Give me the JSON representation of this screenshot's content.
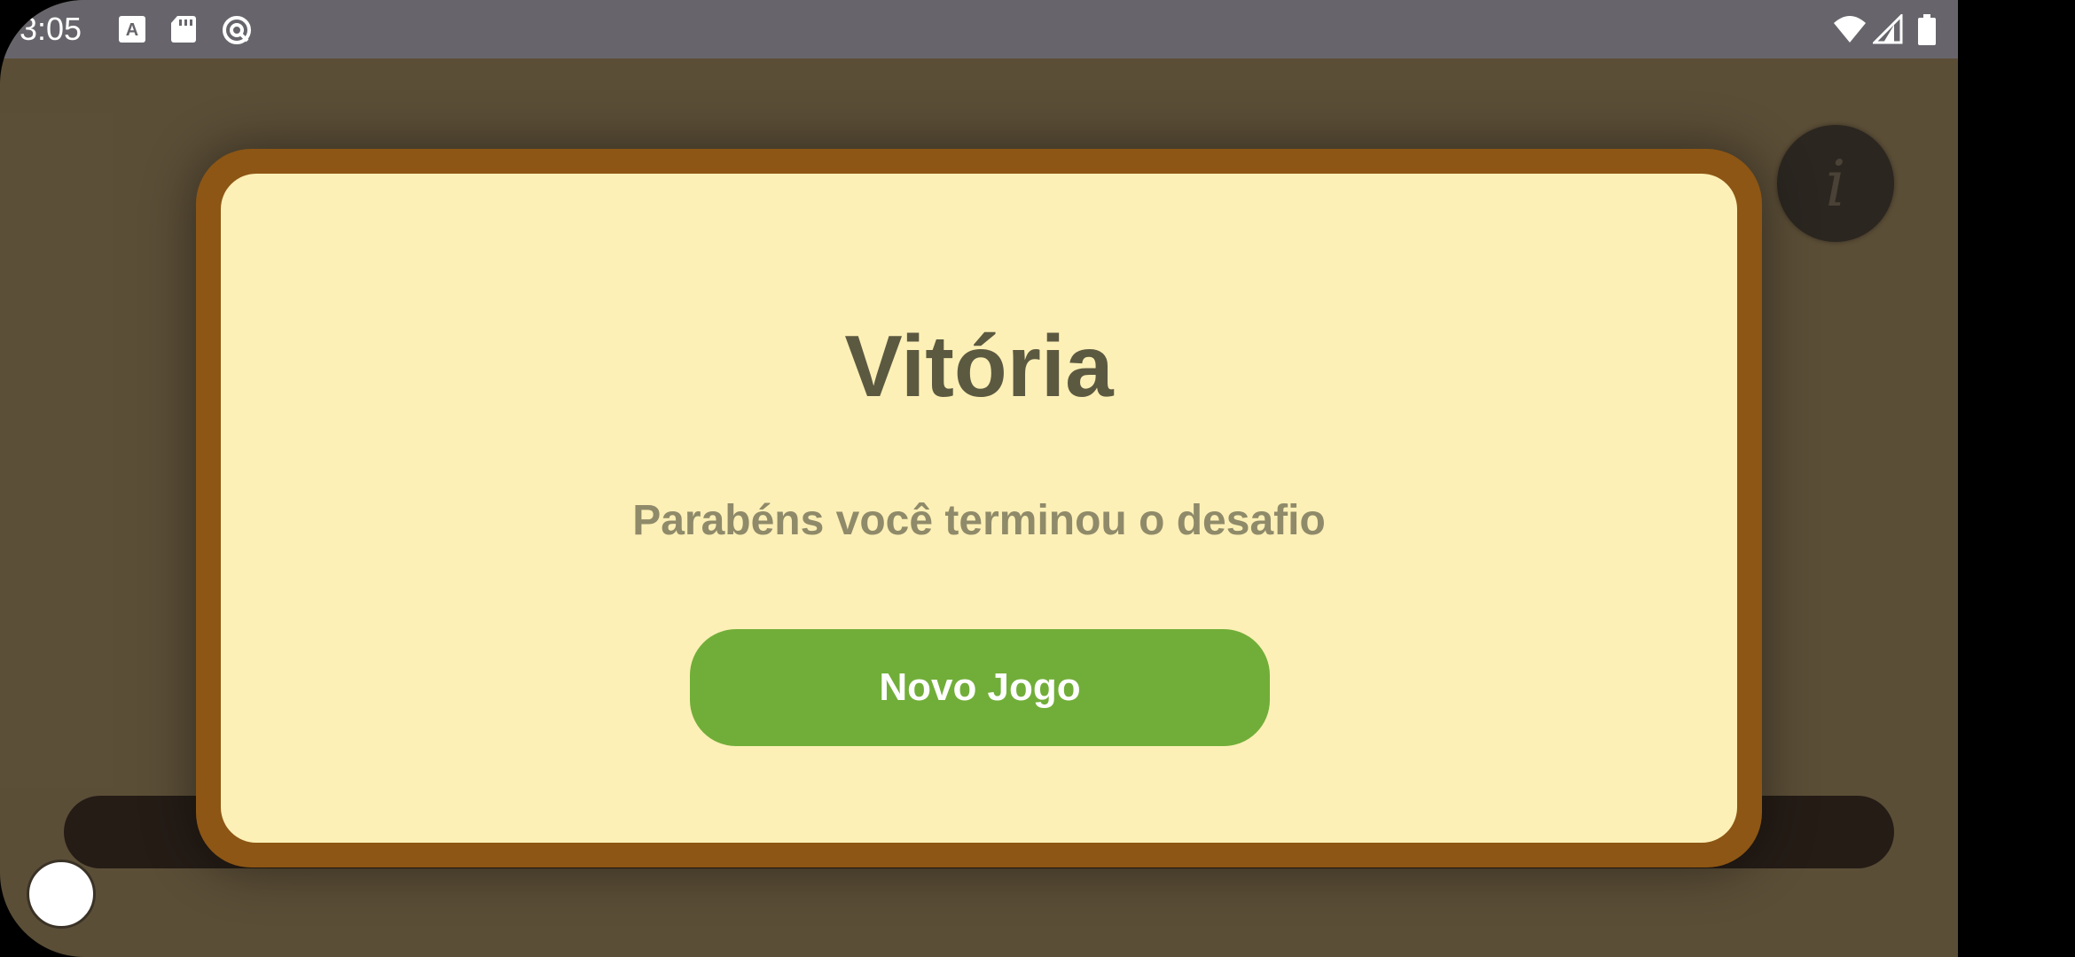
{
  "status_bar": {
    "time": "3:05",
    "left_icons": [
      "text-format-icon",
      "sd-card-icon",
      "data-saver-icon"
    ],
    "right_icons": [
      "wifi-icon",
      "cellular-signal-icon",
      "battery-icon"
    ]
  },
  "game": {
    "info_button": {
      "icon": "info-icon",
      "glyph": "i"
    }
  },
  "dialog": {
    "title": "Vitória",
    "message": "Parabéns você terminou o desafio",
    "button_label": "Novo Jogo"
  },
  "nav_bar": {
    "items": [
      "recents-square-icon",
      "home-circle-icon",
      "back-triangle-icon"
    ]
  },
  "colors": {
    "background": "#60533a",
    "dialog_frame": "#8d5614",
    "dialog_fill": "#fcf0b6",
    "title_text": "#5c5941",
    "message_text": "#8f8a69",
    "button": "#71ae39",
    "status_bar": "#67656b"
  }
}
